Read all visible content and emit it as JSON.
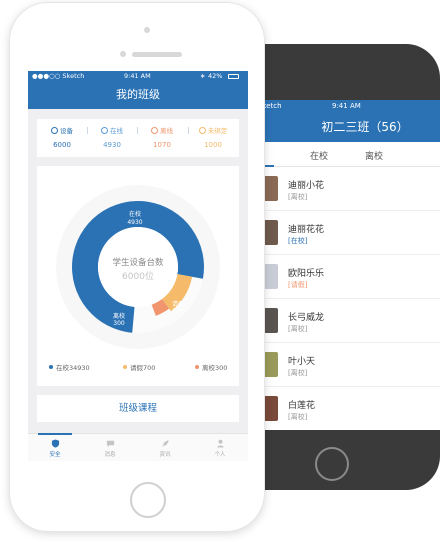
{
  "front": {
    "status": {
      "carrier": "●●●○○ Sketch",
      "time": "9:41 AM",
      "battery": "42%"
    },
    "title": "我的班级",
    "stats": [
      {
        "label": "设备",
        "value": "6000",
        "color": "#2b72b5"
      },
      {
        "label": "在线",
        "value": "4930",
        "color": "#5d9bd6"
      },
      {
        "label": "离线",
        "value": "1070",
        "color": "#f0956e"
      },
      {
        "label": "未绑定",
        "value": "1000",
        "color": "#f5bb6a"
      }
    ],
    "chart": {
      "center_title": "学生设备台数",
      "center_value": "6000位",
      "seg_labels": [
        {
          "name": "在校",
          "value": "4930"
        },
        {
          "name": "请假",
          "value": "770"
        },
        {
          "name": "离校",
          "value": "300"
        }
      ],
      "legend": [
        {
          "text": "在校34930",
          "color": "#2b72b5"
        },
        {
          "text": "请假700",
          "color": "#f5bb6a"
        },
        {
          "text": "离校300",
          "color": "#f0956e"
        }
      ]
    },
    "course_button": "班级课程",
    "tabbar": [
      {
        "label": "安全",
        "icon": "shield-icon"
      },
      {
        "label": "消息",
        "icon": "message-icon"
      },
      {
        "label": "资讯",
        "icon": "news-icon"
      },
      {
        "label": "个人",
        "icon": "person-icon"
      }
    ]
  },
  "chart_data": {
    "type": "pie",
    "categories": [
      "在校",
      "请假",
      "离校"
    ],
    "values": [
      4930,
      770,
      300
    ],
    "colors": [
      "#2b72b5",
      "#f5bb6a",
      "#f0956e"
    ],
    "total": 6000
  },
  "back": {
    "status": {
      "carrier": "Sketch",
      "time": "9:41 AM"
    },
    "title": "初二三班（56）",
    "tabs": [
      "在校",
      "离校"
    ],
    "students": [
      {
        "name": "迪丽小花",
        "status": "[离校]",
        "status_color": "#999999",
        "avatar": "#8a6a55"
      },
      {
        "name": "迪丽花花",
        "status": "[在校]",
        "status_color": "#2b72b5",
        "avatar": "#6f5a4c"
      },
      {
        "name": "欧阳乐乐",
        "status": "[请假]",
        "status_color": "#f0956e",
        "avatar": "#c9ccd6"
      },
      {
        "name": "长弓威龙",
        "status": "[离校]",
        "status_color": "#999999",
        "avatar": "#5a5550"
      },
      {
        "name": "叶小天",
        "status": "[离校]",
        "status_color": "#999999",
        "avatar": "#9a9a5a"
      },
      {
        "name": "白莲花",
        "status": "[离校]",
        "status_color": "#999999",
        "avatar": "#7a4a3a"
      }
    ]
  }
}
